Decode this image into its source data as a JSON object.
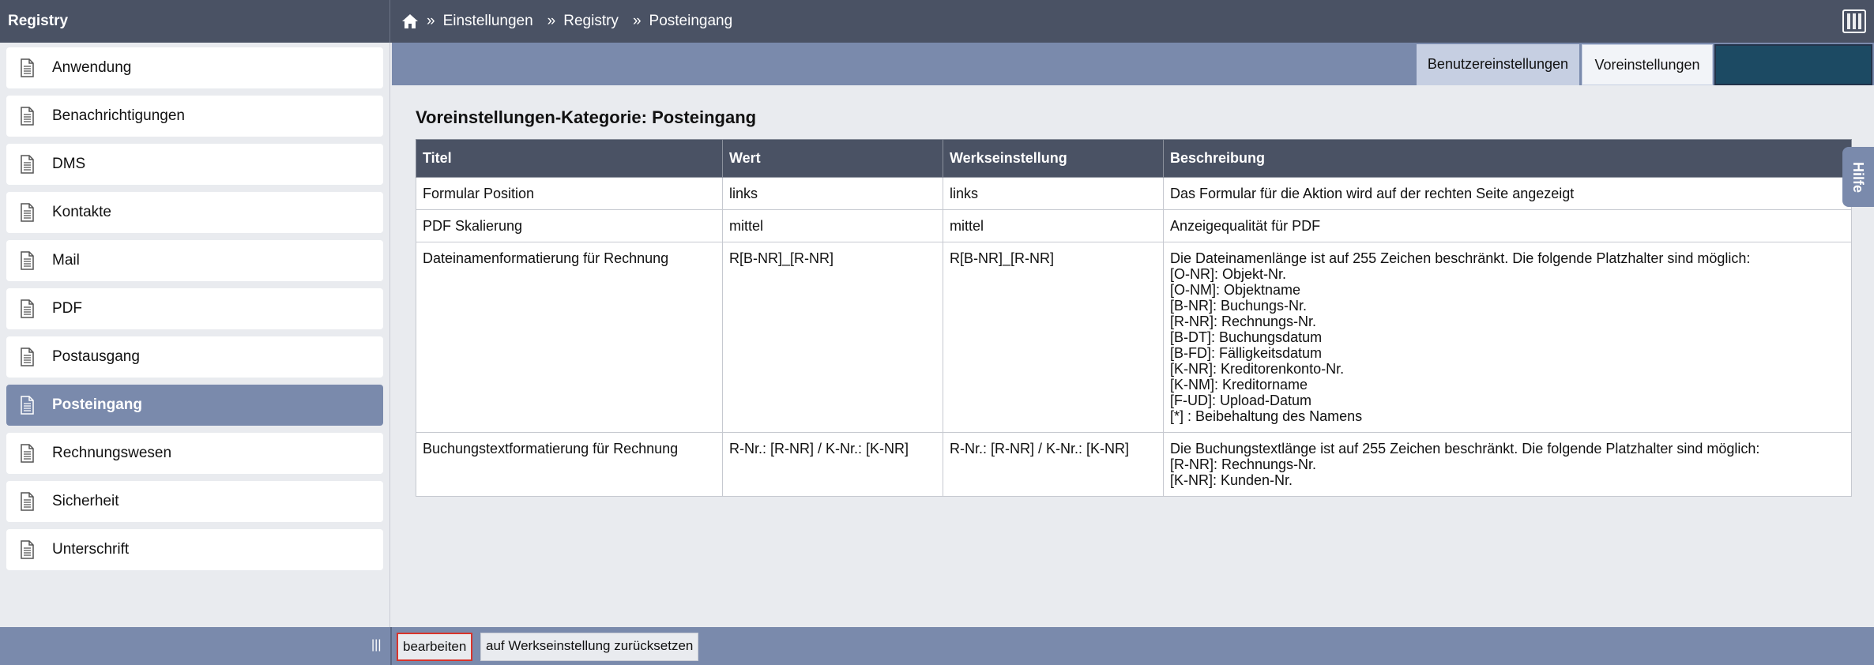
{
  "header": {
    "app_title": "Registry",
    "breadcrumb": {
      "separator": "»",
      "items": [
        "Einstellungen",
        "Registry",
        "Posteingang"
      ]
    }
  },
  "sidebar": {
    "items": [
      {
        "label": "Anwendung",
        "active": false
      },
      {
        "label": "Benachrichtigungen",
        "active": false
      },
      {
        "label": "DMS",
        "active": false
      },
      {
        "label": "Kontakte",
        "active": false
      },
      {
        "label": "Mail",
        "active": false
      },
      {
        "label": "PDF",
        "active": false
      },
      {
        "label": "Postausgang",
        "active": false
      },
      {
        "label": "Posteingang",
        "active": true
      },
      {
        "label": "Rechnungswesen",
        "active": false
      },
      {
        "label": "Sicherheit",
        "active": false
      },
      {
        "label": "Unterschrift",
        "active": false
      }
    ]
  },
  "tabs": {
    "user_settings": "Benutzereinstellungen",
    "presets": "Voreinstellungen",
    "third": ""
  },
  "main": {
    "title": "Voreinstellungen-Kategorie: Posteingang",
    "columns": [
      "Titel",
      "Wert",
      "Werkseinstellung",
      "Beschreibung"
    ],
    "rows": [
      {
        "title": "Formular Position",
        "value": "links",
        "default": "links",
        "description": [
          "Das Formular für die Aktion wird auf der rechten Seite angezeigt"
        ]
      },
      {
        "title": "PDF Skalierung",
        "value": "mittel",
        "default": "mittel",
        "description": [
          "Anzeigequalität für PDF"
        ]
      },
      {
        "title": "Dateinamenformatierung für Rechnung",
        "value": "R[B-NR]_[R-NR]",
        "default": "R[B-NR]_[R-NR]",
        "description": [
          "Die Dateinamenlänge ist auf 255 Zeichen beschränkt. Die folgende Platzhalter sind möglich:",
          "[O-NR]: Objekt-Nr.",
          "[O-NM]: Objektname",
          "[B-NR]: Buchungs-Nr.",
          "[R-NR]: Rechnungs-Nr.",
          "[B-DT]: Buchungsdatum",
          "[B-FD]: Fälligkeitsdatum",
          "[K-NR]: Kreditorenkonto-Nr.",
          "[K-NM]: Kreditorname",
          "[F-UD]: Upload-Datum",
          "[*] : Beibehaltung des Namens"
        ]
      },
      {
        "title": "Buchungstextformatierung für Rechnung",
        "value": "R-Nr.: [R-NR] / K-Nr.: [K-NR]",
        "default": "R-Nr.: [R-NR] / K-Nr.: [K-NR]",
        "description": [
          "Die Buchungstextlänge ist auf 255 Zeichen beschränkt. Die folgende Platzhalter sind möglich:",
          "[R-NR]: Rechnungs-Nr.",
          "[K-NR]: Kunden-Nr."
        ]
      }
    ]
  },
  "help_tab": "Hilfe",
  "footer": {
    "splitter": "|||",
    "edit_button": "bearbeiten",
    "reset_button": "auf Werkseinstellung zurücksetzen"
  },
  "icons": {
    "home": "home-icon",
    "layout": "layout-toggle-icon",
    "document": "document-icon"
  },
  "colors": {
    "header_bg": "#4a5264",
    "accent": "#7a8aac",
    "active_item": "#7a8aac",
    "highlight_border": "#d9342b"
  }
}
